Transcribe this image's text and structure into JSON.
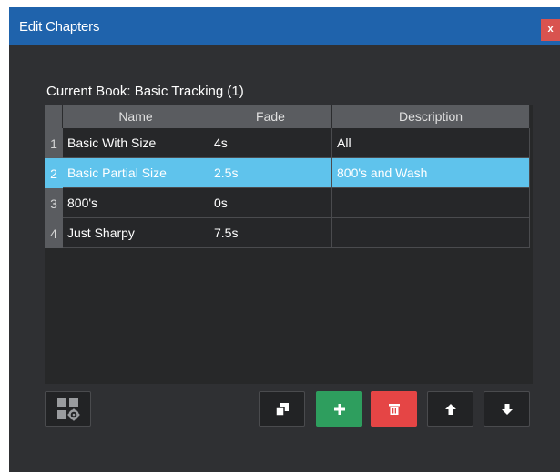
{
  "window": {
    "title": "Edit Chapters",
    "close_label": "x"
  },
  "book_label": "Current Book: Basic Tracking (1)",
  "table": {
    "columns": [
      "Name",
      "Fade",
      "Description"
    ],
    "rows": [
      {
        "num": "1",
        "name": "Basic With Size",
        "fade": "4s",
        "description": "All",
        "selected": false
      },
      {
        "num": "2",
        "name": "Basic Partial Size",
        "fade": "2.5s",
        "description": "800's and Wash",
        "selected": true
      },
      {
        "num": "3",
        "name": "800's",
        "fade": "0s",
        "description": "",
        "selected": false
      },
      {
        "num": "4",
        "name": "Just Sharpy",
        "fade": "7.5s",
        "description": "",
        "selected": false
      }
    ]
  },
  "toolbar": {
    "icons": [
      "grid-settings-icon",
      "duplicate-icon",
      "plus-icon",
      "trash-icon",
      "arrow-up-icon",
      "arrow-down-icon"
    ]
  },
  "colors": {
    "titlebar": "#1f63ac",
    "selection": "#5fc3ec",
    "add": "#2e9e5e",
    "delete": "#e54545"
  }
}
